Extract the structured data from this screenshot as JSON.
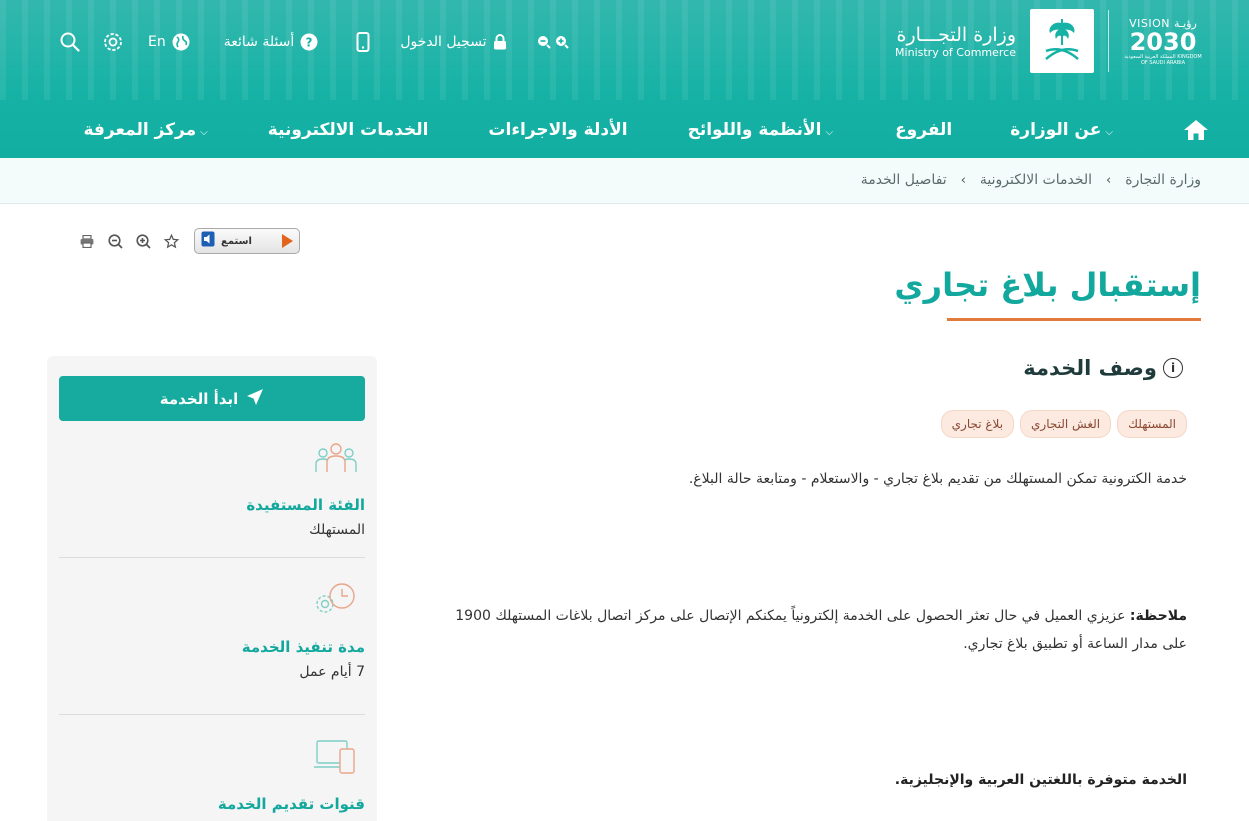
{
  "header": {
    "topbar": {
      "language": "En",
      "faq": "أسئلة شائعة",
      "login": "تسجيل الدخول"
    },
    "ministry_ar": "وزارة التجـــارة",
    "ministry_en": "Ministry of Commerce",
    "vision_line1": "VISION رؤيـة",
    "vision_year": "2030",
    "vision_kingdom": "المملكة العربية السعودية KINGDOM OF SAUDI ARABIA",
    "nav": [
      {
        "label": "عن الوزارة"
      },
      {
        "label": "الفروع"
      },
      {
        "label": "الأنظمة واللوائح"
      },
      {
        "label": "الأدلة والاجراءات"
      },
      {
        "label": "الخدمات الالكترونية"
      },
      {
        "label": "مركز المعرفة"
      }
    ]
  },
  "breadcrumb": [
    "وزارة التجارة",
    "الخدمات الالكترونية",
    "تفاصيل الخدمة"
  ],
  "tools": {
    "listen_label": "استمع"
  },
  "page": {
    "title": "إستقبال بلاغ تجاري",
    "section_title": "وصف الخدمة",
    "tags": [
      "المستهلك",
      "الغش التجاري",
      "بلاغ تجاري"
    ],
    "description": "خدمة الكترونية تمكن المستهلك من تقديم بلاغ تجاري - والاستعلام - ومتابعة حالة البلاغ.",
    "note_label": "ملاحظة:",
    "note_text": " عزيزي العميل في حال تعثر الحصول على الخدمة إلكترونياً يمكنكم الإتصال على مركز اتصال بلاغات المستهلك 1900 على مدار الساعة أو تطبيق بلاغ تجاري.",
    "languages": "الخدمة متوفرة باللغتين العربية والإنجليزية."
  },
  "sidebar": {
    "start_button": "ابدأ الخدمة",
    "beneficiary_label": "الفئة المستفيدة",
    "beneficiary_value": "المستهلك",
    "duration_label": "مدة تنفيذ الخدمة",
    "duration_value": "7 أيام عمل",
    "channels_label": "قنوات تقديم الخدمة"
  },
  "colors": {
    "primary": "#17aa9f",
    "accent": "#e07b3c",
    "tag_bg": "#fce9e0"
  }
}
